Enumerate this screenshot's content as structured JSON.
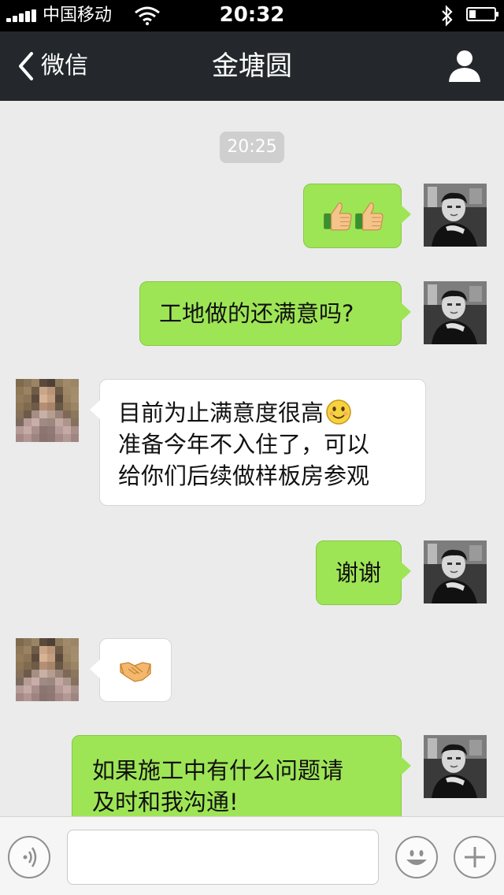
{
  "status": {
    "carrier": "中国移动",
    "time": "20:32"
  },
  "nav": {
    "back_label": "微信",
    "title": "金塘圆"
  },
  "chat": {
    "timestamp": "20:25",
    "messages": [
      {
        "direction": "out",
        "text": "",
        "emoji": [
          "thumbs-up",
          "thumbs-up"
        ]
      },
      {
        "direction": "out",
        "text": "工地做的还满意吗?"
      },
      {
        "direction": "in",
        "lines": [
          "目前为止满意度很高",
          "准备今年不入住了，可以",
          "给你们后续做样板房参观"
        ],
        "emoji_inline": "smile"
      },
      {
        "direction": "out",
        "text": "谢谢"
      },
      {
        "direction": "in",
        "text": "",
        "emoji": [
          "handshake"
        ]
      },
      {
        "direction": "out",
        "lines": [
          "如果施工中有什么问题请",
          "及时和我沟通!"
        ]
      }
    ]
  },
  "input_bar": {
    "placeholder": "",
    "icons": [
      "voice-icon",
      "emoji-icon",
      "plus-icon"
    ]
  },
  "colors": {
    "outgoing_bubble": "#9ee556",
    "incoming_bubble": "#ffffff",
    "nav_bg": "#24282c",
    "chat_bg": "#ebebeb"
  }
}
